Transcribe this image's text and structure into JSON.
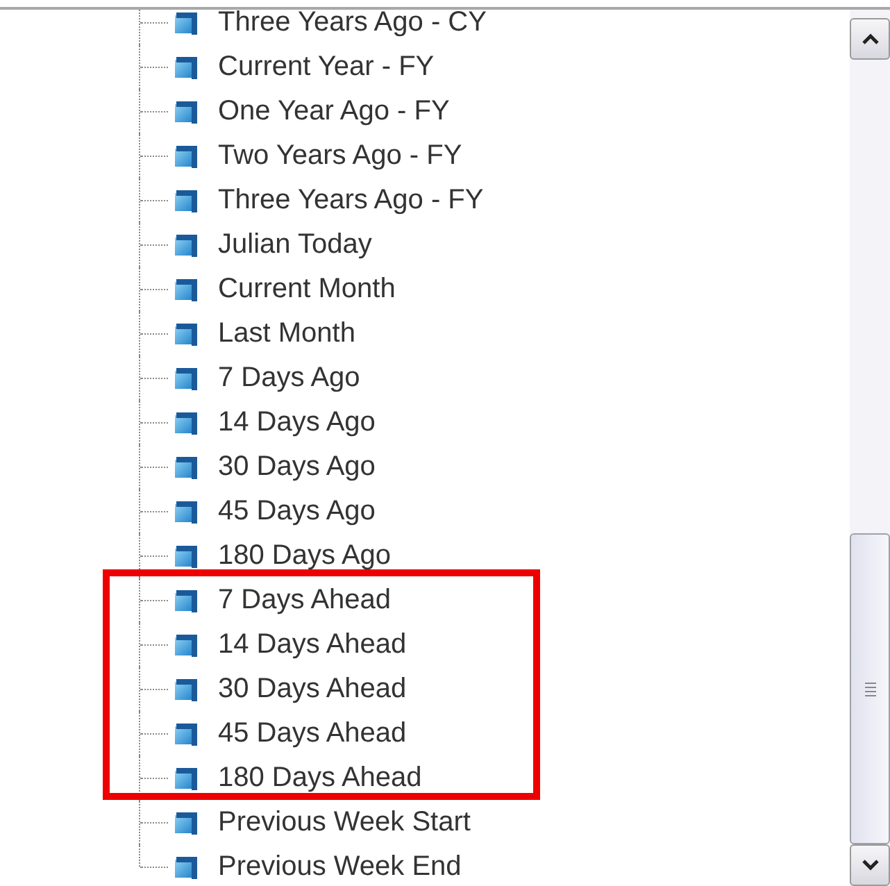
{
  "tree": {
    "items": [
      {
        "label": "Three Years Ago - CY",
        "highlighted": false
      },
      {
        "label": "Current Year - FY",
        "highlighted": false
      },
      {
        "label": "One Year Ago - FY",
        "highlighted": false
      },
      {
        "label": "Two Years Ago - FY",
        "highlighted": false
      },
      {
        "label": "Three Years Ago - FY",
        "highlighted": false
      },
      {
        "label": "Julian Today",
        "highlighted": false
      },
      {
        "label": "Current Month",
        "highlighted": false
      },
      {
        "label": "Last Month",
        "highlighted": false
      },
      {
        "label": "7 Days Ago",
        "highlighted": false
      },
      {
        "label": "14 Days Ago",
        "highlighted": false
      },
      {
        "label": "30 Days Ago",
        "highlighted": false
      },
      {
        "label": "45 Days Ago",
        "highlighted": false
      },
      {
        "label": "180 Days Ago",
        "highlighted": false
      },
      {
        "label": "7 Days Ahead",
        "highlighted": true
      },
      {
        "label": "14 Days Ahead",
        "highlighted": true
      },
      {
        "label": "30 Days Ahead",
        "highlighted": true
      },
      {
        "label": "45 Days Ahead",
        "highlighted": true
      },
      {
        "label": "180 Days Ahead",
        "highlighted": true
      },
      {
        "label": "Previous Week Start",
        "highlighted": false
      },
      {
        "label": "Previous Week End",
        "highlighted": false
      }
    ]
  }
}
